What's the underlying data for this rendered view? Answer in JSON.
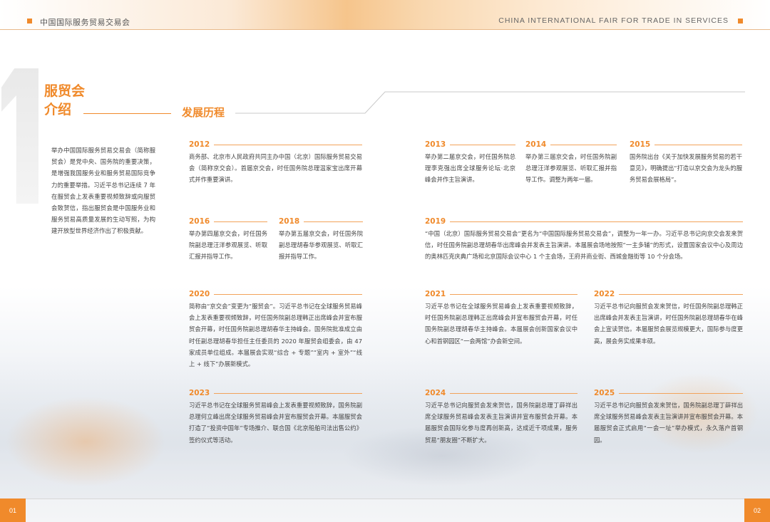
{
  "header": {
    "left_title": "中国国际服务贸易交易会",
    "right_title": "CHINA INTERNATIONAL FAIR FOR TRADE IN SERVICES"
  },
  "section": {
    "number": "1",
    "title_line1": "服贸会",
    "title_line2": "介绍",
    "subtitle": "发展历程"
  },
  "intro": "举办中国国际服务贸易交易会（简称服贸会）是党中央、国务院的重要决策，是增强我国服务业和服务贸易国际竞争力的重要举措。习近平总书记连续 7 年在服贸会上发表重要视频致辞或向服贸会致贺信，指出服贸会是中国服务业和服务贸易高质量发展的生动写照，为构建开放型世界经济作出了积极贡献。",
  "timeline": [
    {
      "year": "2012",
      "text": "商务部、北京市人民政府共同主办中国（北京）国际服务贸易交易会（简称京交会）。首届京交会，时任国务院总理温家宝出席开幕式并作重要演讲。"
    },
    {
      "year": "2013",
      "text": "举办第二届京交会，时任国务院总理李克强出席全球服务论坛·北京峰会并作主旨演讲。"
    },
    {
      "year": "2014",
      "text": "举办第三届京交会，时任国务院副总理汪洋参观展览、听取汇报并指导工作。调整为两年一届。"
    },
    {
      "year": "2015",
      "text": "国务院出台《关于加快发展服务贸易的若干意见》，明确提出“打造以京交会为龙头的服务贸易会展格局”。"
    },
    {
      "year": "2016",
      "text": "举办第四届京交会，时任国务院副总理汪洋参观展览、听取汇报并指导工作。"
    },
    {
      "year": "2018",
      "text": "举办第五届京交会，时任国务院副总理胡春华参观展览、听取汇报并指导工作。"
    },
    {
      "year": "2019",
      "text": "“中国（北京）国际服务贸易交易会”更名为“中国国际服务贸易交易会”，调整为一年一办。习近平总书记向京交会发来贺信，时任国务院副总理胡春华出席峰会并发表主旨演讲。本届展会场地按照“一主多辅”的形式，设置国家会议中心及周边的奥林匹克庆典广场和北京国际会议中心 1 个主会场，王府井商业街、西城金融街等 10 个分会场。"
    },
    {
      "year": "2020",
      "text": "简称由“京交会”变更为“服贸会”。习近平总书记在全球服务贸易峰会上发表重要视频致辞，时任国务院副总理韩正出席峰会并宣布服贸会开幕，时任国务院副总理胡春华主持峰会。国务院批准成立由时任副总理胡春华担任主任委员的 2020 年服贸会组委会，由 47 家成员单位组成。本届展会实现“综合 + 专题”“室内 + 室外”“线上 + 线下”办展新模式。"
    },
    {
      "year": "2021",
      "text": "习近平总书记在全球服务贸易峰会上发表重要视频致辞，时任国务院副总理韩正出席峰会并宣布服贸会开幕，时任国务院副总理胡春华主持峰会。本届展会创新国家会议中心和首钢园区“一会两馆”办会新空间。"
    },
    {
      "year": "2022",
      "text": "习近平总书记向服贸会发来贺信，时任国务院副总理韩正出席峰会并发表主旨演讲，时任国务院副总理胡春华在峰会上宣读贺信。本届服贸会展览规模更大，国际参与度更高，展会务实成果丰硕。"
    },
    {
      "year": "2023",
      "text": "习近平总书记在全球服务贸易峰会上发表重要视频致辞，国务院副总理何立峰出席全球服务贸易峰会并宣布服贸会开幕。本届服贸会打造了“投资中国年”专场推介、联合国《北京船舶司法出售公约》签约仪式等活动。"
    },
    {
      "year": "2024",
      "text": "习近平总书记向服贸会发来贺信，国务院副总理丁薛祥出席全球服务贸易峰会发表主旨演讲并宣布服贸会开幕。本届服贸会国际化参与度再创新高，达成近千项成果，服务贸易“朋友圈”不断扩大。"
    },
    {
      "year": "2025",
      "text": "习近平总书记向服贸会发来贺信，国务院副总理丁薛祥出席全球服务贸易峰会发表主旨演讲并宣布服贸会开幕。本届服贸会正式启用“一会一址”举办模式，永久落户首钢园。"
    }
  ],
  "footer": {
    "page_left": "01",
    "page_right": "02"
  },
  "colors": {
    "accent": "#f08a2b",
    "text": "#444444"
  }
}
